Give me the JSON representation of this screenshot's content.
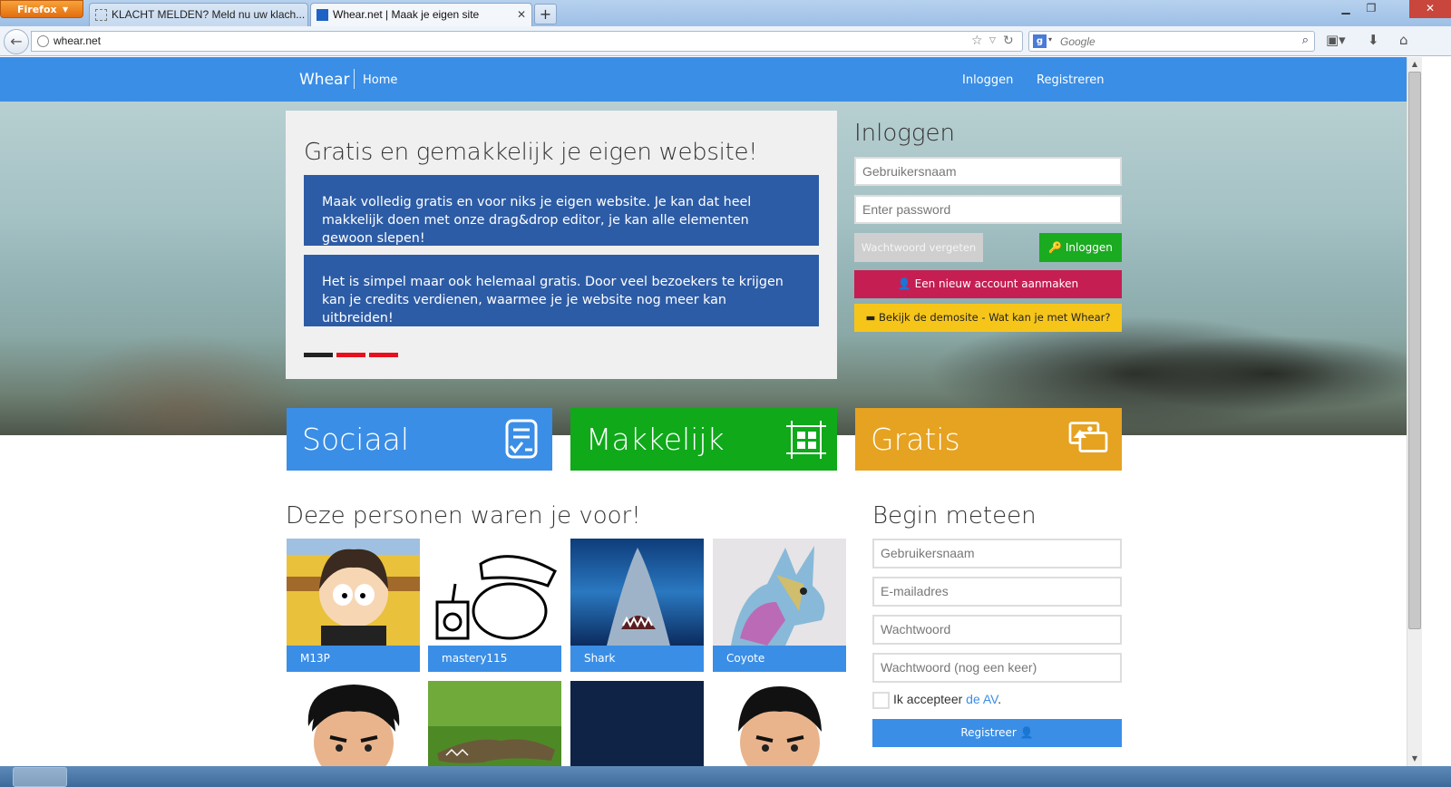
{
  "browser": {
    "menu_button": "Firefox",
    "tabs": [
      {
        "title": "KLACHT MELDEN? Meld nu uw klach..."
      },
      {
        "title": "Whear.net | Maak je eigen site"
      }
    ],
    "url": "whear.net",
    "search_placeholder": "Google"
  },
  "site_nav": {
    "brand": "Whear",
    "home": "Home",
    "login": "Inloggen",
    "register": "Registreren"
  },
  "slider": {
    "title": "Gratis en gemakkelijk je eigen website!",
    "slide1": "Maak volledig gratis en voor niks je eigen website. Je kan dat heel makkelijk doen met onze drag&drop editor, je kan alle elementen gewoon slepen!",
    "slide2": "Het is simpel maar ook helemaal gratis. Door veel bezoekers te krijgen kan je credits verdienen, waarmee je je website nog meer kan uitbreiden!"
  },
  "login": {
    "title": "Inloggen",
    "username_placeholder": "Gebruikersnaam",
    "password_placeholder": "Enter password",
    "forgot": "Wachtwoord vergeten",
    "submit": "Inloggen",
    "new_account": "Een nieuw account aanmaken",
    "demo": "Bekijk de demosite - Wat kan je met Whear?"
  },
  "features": {
    "social": "Sociaal",
    "easy": "Makkelijk",
    "free": "Gratis"
  },
  "people": {
    "title": "Deze personen waren je voor!",
    "items": [
      {
        "name": "M13P"
      },
      {
        "name": "mastery115"
      },
      {
        "name": "Shark"
      },
      {
        "name": "Coyote"
      }
    ]
  },
  "register": {
    "title": "Begin meteen",
    "username_placeholder": "Gebruikersnaam",
    "email_placeholder": "E-mailadres",
    "password_placeholder": "Wachtwoord",
    "password2_placeholder": "Wachtwoord (nog een keer)",
    "accept_prefix": "Ik accepteer",
    "accept_link": "de AV",
    "accept_suffix": ".",
    "submit": "Registreer"
  },
  "colors": {
    "primary": "#3a8ee6",
    "slide_box": "#2d5ca6",
    "login_green": "#1aab20",
    "new_account": "#c51e52",
    "demo_yellow": "#f6c51a",
    "tile_green": "#0fa91a",
    "tile_orange": "#e6a221"
  }
}
